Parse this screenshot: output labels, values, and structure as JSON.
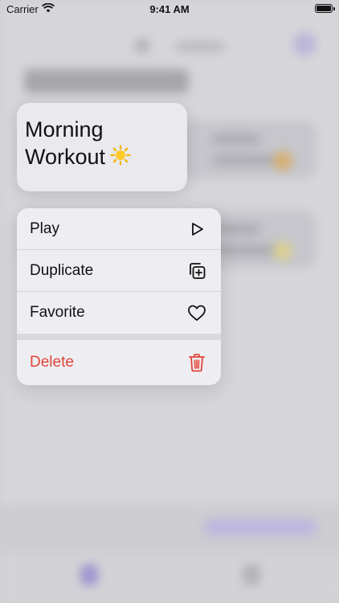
{
  "status_bar": {
    "carrier": "Carrier",
    "time": "9:41 AM"
  },
  "preview": {
    "title": "Morning Workout",
    "emoji_icon": "sun-icon"
  },
  "menu": {
    "items": [
      {
        "label": "Play",
        "icon": "play-icon"
      },
      {
        "label": "Duplicate",
        "icon": "duplicate-icon"
      },
      {
        "label": "Favorite",
        "icon": "heart-icon"
      }
    ],
    "destructive": {
      "label": "Delete",
      "icon": "trash-icon",
      "color": "#e0443a"
    }
  },
  "colors": {
    "accent": "#9f95cf",
    "danger": "#e0443a"
  }
}
